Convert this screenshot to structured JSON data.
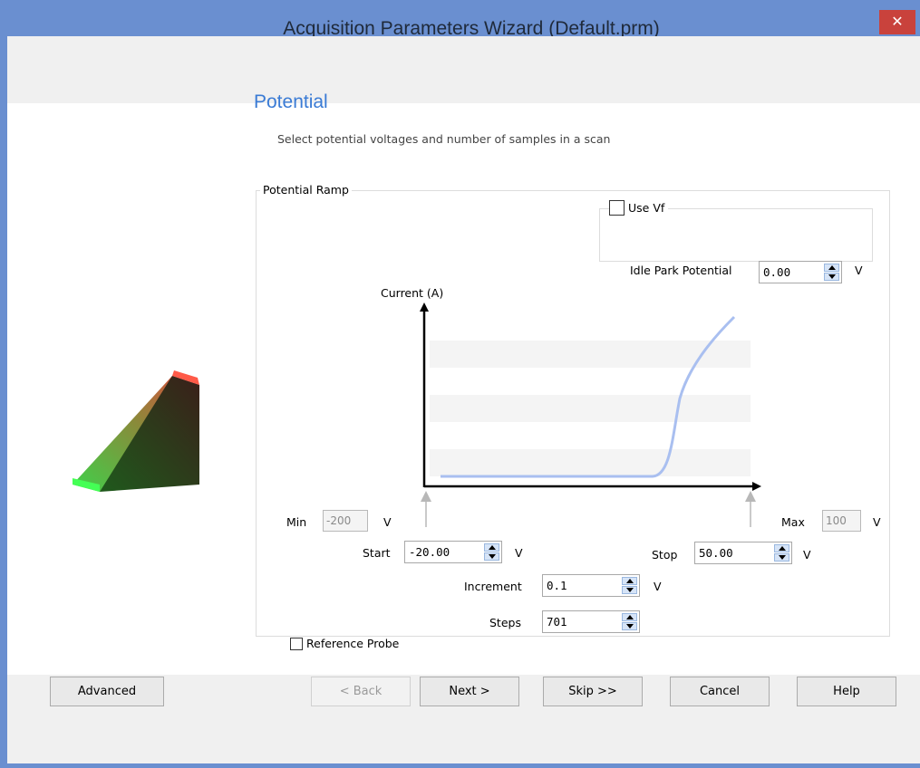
{
  "window": {
    "title": "Acquisition Parameters Wizard (Default.prm)",
    "close_glyph": "✕"
  },
  "page": {
    "heading": "Potential",
    "subtitle": "Select potential voltages and number of samples in a scan"
  },
  "group": {
    "label": "Potential Ramp"
  },
  "vf": {
    "use_vf_label": "Use Vf",
    "use_vf_checked": false,
    "idle_park_label": "Idle Park Potential",
    "idle_park_value": "0.00",
    "idle_park_unit": "V"
  },
  "plot": {
    "y_axis_label": "Current (A)"
  },
  "fields": {
    "min_label": "Min",
    "min_value": "-200",
    "min_unit": "V",
    "max_label": "Max",
    "max_value": "100",
    "max_unit": "V",
    "start_label": "Start",
    "start_value": "-20.00",
    "start_unit": "V",
    "stop_label": "Stop",
    "stop_value": "50.00",
    "stop_unit": "V",
    "increment_label": "Increment",
    "increment_value": "0.1",
    "increment_unit": "V",
    "steps_label": "Steps",
    "steps_value": "701",
    "reference_probe_label": "Reference Probe",
    "reference_probe_checked": false
  },
  "buttons": {
    "advanced": "Advanced",
    "back": "< Back",
    "next": "Next >",
    "skip": "Skip >>",
    "cancel": "Cancel",
    "help": "Help"
  },
  "colors": {
    "accent": "#3a7bd5",
    "titlebar": "#6a8fd0",
    "close": "#c9423c",
    "curve": "#a9bff0"
  }
}
